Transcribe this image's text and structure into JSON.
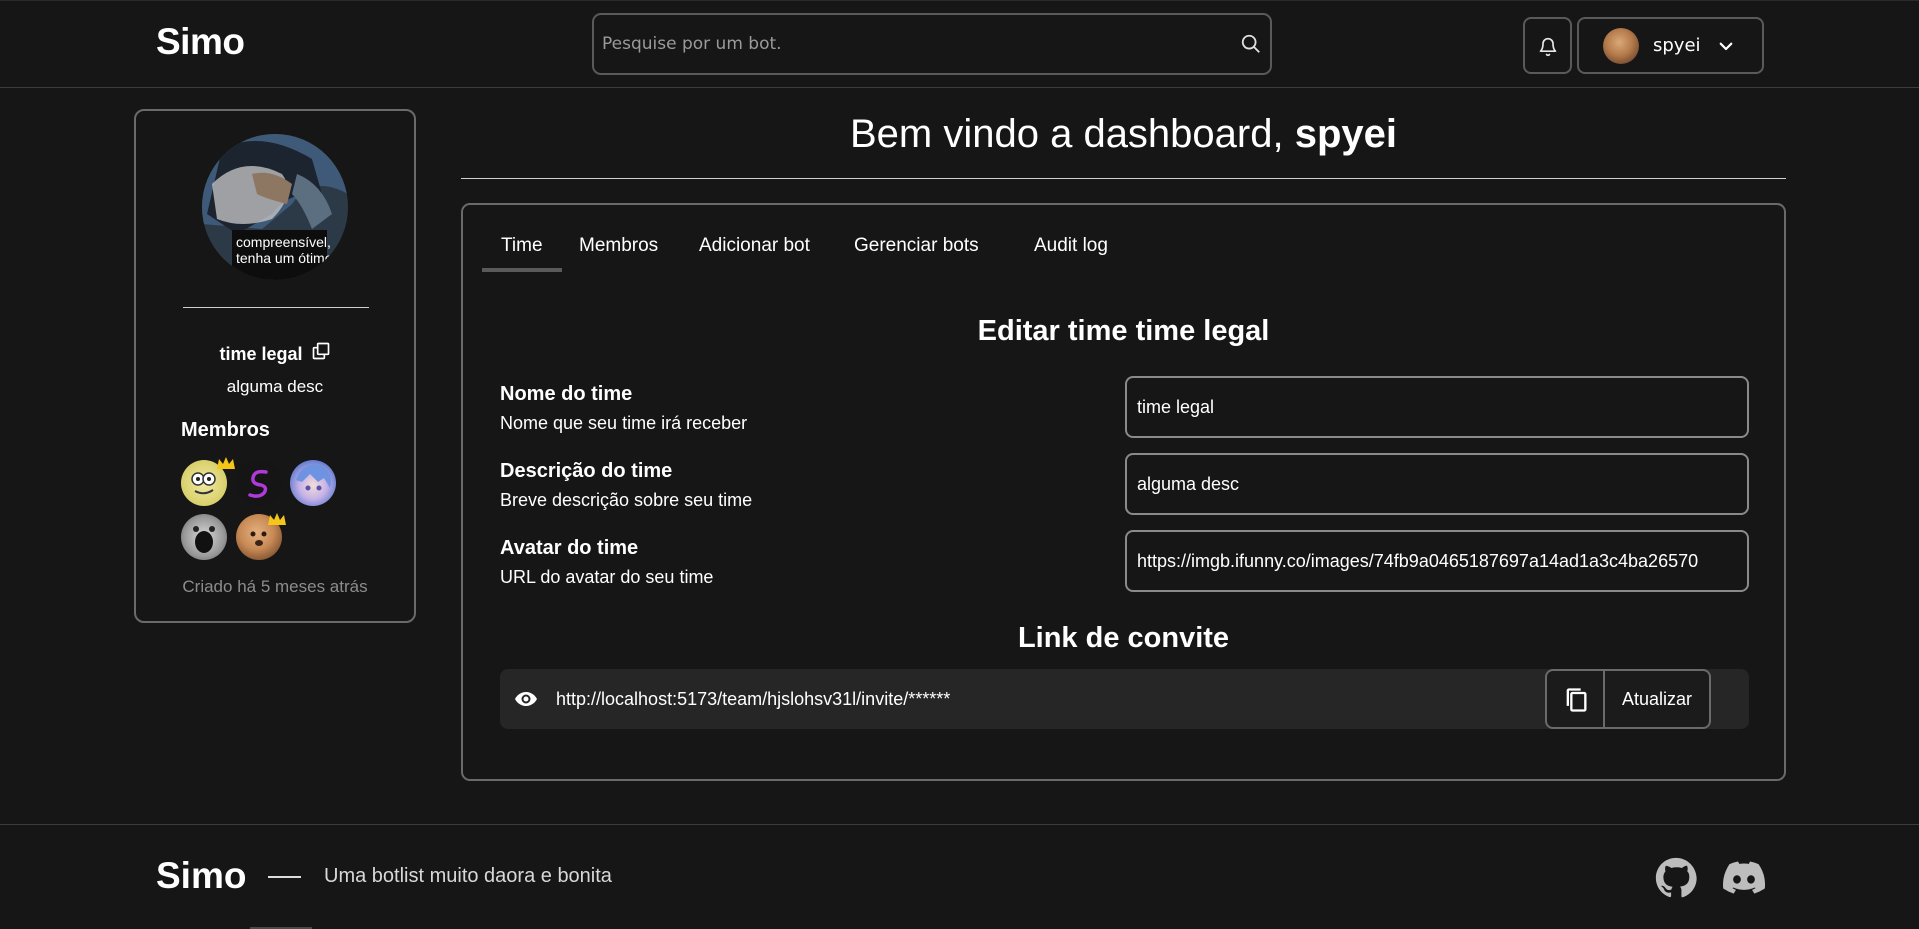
{
  "header": {
    "logo": "Simo",
    "search_placeholder": "Pesquise por um bot.",
    "username": "spyei"
  },
  "sidebar": {
    "team_avatar_caption_line1": "compreensível,",
    "team_avatar_caption_line2": "tenha um ótimo d",
    "team_name": "time legal",
    "team_description": "alguma desc",
    "members_title": "Membros",
    "created_text": "Criado há 5 meses atrás"
  },
  "welcome": {
    "prefix": "Bem vindo a dashboard, ",
    "username": "spyei"
  },
  "tabs": [
    {
      "label": "Time"
    },
    {
      "label": "Membros"
    },
    {
      "label": "Adicionar bot"
    },
    {
      "label": "Gerenciar bots"
    },
    {
      "label": "Audit log"
    }
  ],
  "edit": {
    "title_prefix": "Editar time ",
    "title_name": "time legal",
    "fields": [
      {
        "label": "Nome do time",
        "help": "Nome que seu time irá receber",
        "value": "time legal"
      },
      {
        "label": "Descrição do time",
        "help": "Breve descrição sobre seu time",
        "value": "alguma desc"
      },
      {
        "label": "Avatar do time",
        "help": "URL do avatar do seu time",
        "value": "https://imgb.ifunny.co/images/74fb9a0465187697a14ad1a3c4ba26570"
      }
    ]
  },
  "invite": {
    "title": "Link de convite",
    "url": "http://localhost:5173/team/hjslohsv31l/invite/******",
    "refresh_label": "Atualizar"
  },
  "footer": {
    "logo": "Simo",
    "tagline": "Uma botlist muito daora e bonita"
  },
  "icons": {
    "search": "search-icon",
    "bell": "bell-icon",
    "chevron": "chevron-down-icon",
    "copy": "copy-icon",
    "eye": "eye-icon",
    "github": "github-icon",
    "discord": "discord-icon",
    "crown": "crown-icon"
  },
  "colors": {
    "background": "#161616",
    "border": "#6a6a6a",
    "crown": "#f5c518"
  }
}
